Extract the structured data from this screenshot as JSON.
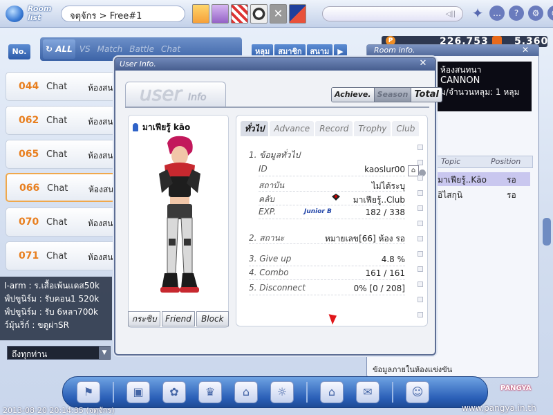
{
  "header": {
    "room_list_label": "Room list",
    "breadcrumb": "จตุจักร > Free#1"
  },
  "filters": {
    "no_label": "No.",
    "tabs": [
      {
        "label": "ALL",
        "active": true
      },
      {
        "label": "VS",
        "active": false
      },
      {
        "label": "Match",
        "active": false
      },
      {
        "label": "Battle",
        "active": false
      },
      {
        "label": "Chat",
        "active": false
      }
    ],
    "sort": [
      "หลุม",
      "สมาชิก",
      "สนาม"
    ]
  },
  "rooms": [
    {
      "num": "044",
      "mode": "Chat",
      "name": "ห้องสน",
      "selected": false
    },
    {
      "num": "062",
      "mode": "Chat",
      "name": "ห้องสน",
      "selected": false
    },
    {
      "num": "065",
      "mode": "Chat",
      "name": "ห้องสน",
      "selected": false
    },
    {
      "num": "066",
      "mode": "Chat",
      "name": "ห้องสน",
      "selected": true
    },
    {
      "num": "070",
      "mode": "Chat",
      "name": "ห้องสน",
      "selected": false
    },
    {
      "num": "071",
      "mode": "Chat",
      "name": "ห้องสน",
      "selected": false
    }
  ],
  "lobby_chat": [
    "I-arm : ร.เสื้อเพ้นเเดส50k",
    "ฟ์ปขูนิร์ม : รับคอน1 520k",
    "ฟ์ปขูนิร์ม : รับ 6หลา700k",
    "ว์มุ้นริ่ก์ : ขดูผ่าSR"
  ],
  "chat_target": "ถึงทุกท่าน",
  "timestamp": "2013-08-20 20:14:35 (จตุจักร)",
  "site_url": "www.pangya.in.th",
  "dock_logo": "PANGYA",
  "currency": {
    "pang": "226,753",
    "cookie": "5,360"
  },
  "room_info": {
    "title": "Room info.",
    "lines": [
      "ห้องสนทนา",
      "CANNON",
      "ม/จำนวนหลุม: 1 หลุม"
    ],
    "columns": [
      "Topic",
      "Position"
    ],
    "players": [
      {
        "name": "มาเฟียรู้..Kāo",
        "position": "รอ",
        "selected": true
      },
      {
        "name": "อิไสกุนิ",
        "position": "รอ",
        "selected": false
      }
    ],
    "footer": "ข้อมูลภายในห้องแข่งขัน"
  },
  "user_info": {
    "title": "User Info.",
    "logo_main": "user",
    "logo_sub": "Info",
    "view_tabs": [
      {
        "label": "Achieve.",
        "active": false
      },
      {
        "label": "Season",
        "active": true
      },
      {
        "label": "Total",
        "active": false
      }
    ],
    "character_name": "มาเฟียรู้ kāo",
    "char_buttons": [
      "กระซิบ",
      "Friend",
      "Block"
    ],
    "info_tabs": [
      {
        "label": "ทั่วไป",
        "active": true
      },
      {
        "label": "Advance",
        "active": false
      },
      {
        "label": "Record",
        "active": false
      },
      {
        "label": "Trophy",
        "active": false
      },
      {
        "label": "Club",
        "active": false
      }
    ],
    "general_section": "1. ข้อมูลทั่วไป",
    "id_label": "ID",
    "id_value": "kaoslur00",
    "status_label": "สถาบัน",
    "status_value": "ไม่ได้ระบุ",
    "club_label": "คลับ",
    "club_value": "มาเฟียรู้..Club",
    "exp_label": "EXP.",
    "exp_rank": "Junior B",
    "exp_value": "182 / 338",
    "state_label": "2. สถานะ",
    "state_value": "หมายเลข[66] ห้อง รอ",
    "giveup_label": "3. Give up",
    "giveup_value": "4.8 %",
    "combo_label": "4. Combo",
    "combo_value": "161 / 161",
    "disconnect_label": "5. Disconnect",
    "disconnect_value": "0% [0 / 208]"
  }
}
